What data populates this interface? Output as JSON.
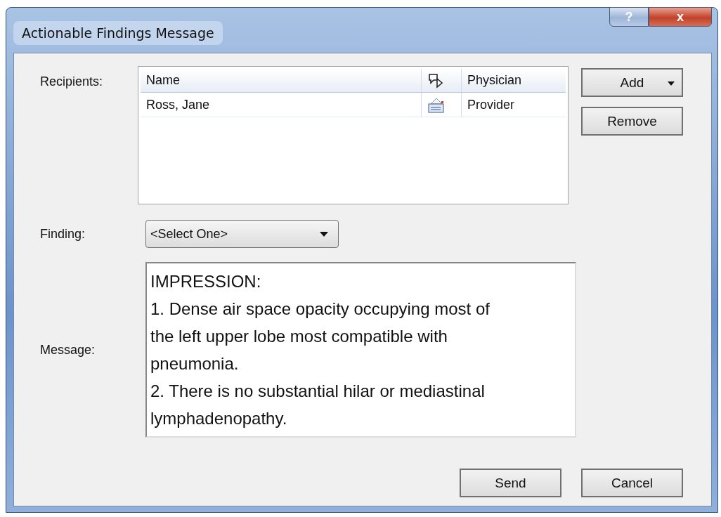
{
  "window": {
    "title": "Actionable Findings Message",
    "buttons": [
      {
        "kind": "help",
        "label": "?"
      },
      {
        "kind": "close",
        "label": "x"
      }
    ]
  },
  "recipients": {
    "label": "Recipients:",
    "columns": [
      {
        "kind": "text",
        "label": "Name"
      },
      {
        "kind": "icon"
      },
      {
        "kind": "text",
        "label": "Physician"
      }
    ],
    "rows": [
      {
        "name": "Ross, Jane",
        "physician": "Provider"
      }
    ]
  },
  "side_buttons": [
    {
      "label": "Add",
      "dropdown": true
    },
    {
      "label": "Remove",
      "dropdown": false
    }
  ],
  "finding": {
    "label": "Finding:",
    "value": "<Select One>"
  },
  "message": {
    "label": "Message:",
    "lines": [
      "IMPRESSION:",
      "1. Dense air space opacity occupying most of",
      "the left upper lobe most compatible with",
      "pneumonia.",
      "2. There is no substantial hilar or mediastinal",
      "lymphadenopathy."
    ]
  },
  "buttons": [
    "Send",
    "Cancel"
  ]
}
